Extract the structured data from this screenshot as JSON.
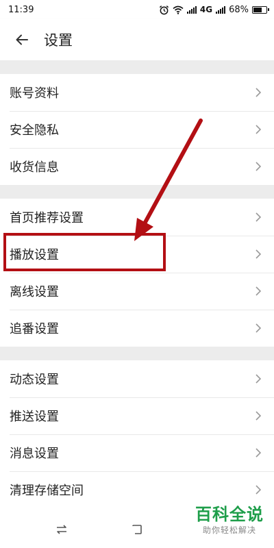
{
  "status_bar": {
    "time": "11:39",
    "network": "4G",
    "battery_text": "68%",
    "battery_level": 0.68
  },
  "header": {
    "title": "设置",
    "back_icon": "arrow-left-icon"
  },
  "groups": [
    {
      "items": [
        {
          "label": "账号资料"
        },
        {
          "label": "安全隐私"
        },
        {
          "label": "收货信息"
        }
      ]
    },
    {
      "items": [
        {
          "label": "首页推荐设置"
        },
        {
          "label": "播放设置"
        },
        {
          "label": "离线设置"
        },
        {
          "label": "追番设置"
        }
      ]
    },
    {
      "items": [
        {
          "label": "动态设置"
        },
        {
          "label": "推送设置"
        },
        {
          "label": "消息设置"
        },
        {
          "label": "清理存储空间"
        }
      ]
    }
  ],
  "annotation": {
    "highlighted_item": "播放设置",
    "color": "#b30f14"
  },
  "watermark": {
    "title": "百科全说",
    "subtitle": "助你轻松解决"
  },
  "colors": {
    "separator": "#ececec",
    "text": "#222222",
    "chevron": "#9a9a9a",
    "watermark_green": "#1e9e4a"
  }
}
